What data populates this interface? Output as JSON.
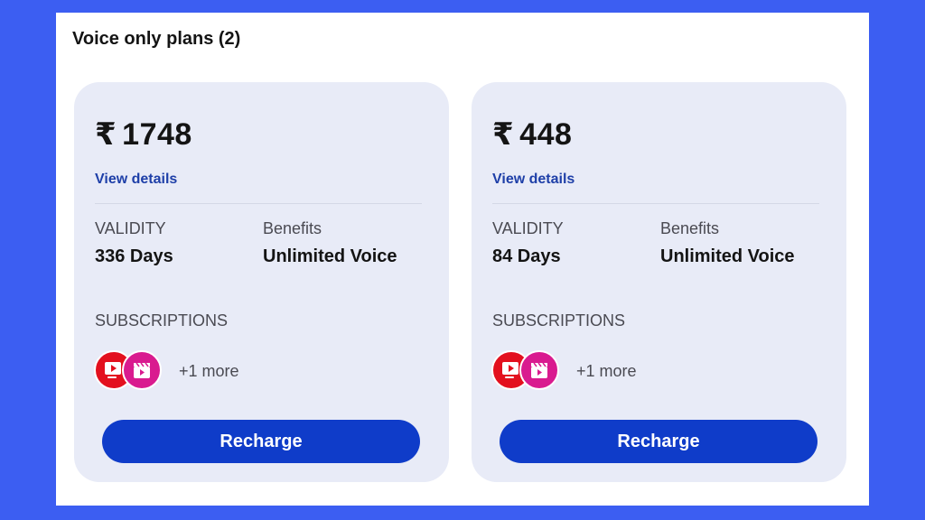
{
  "section": {
    "title": "Voice only plans (2)"
  },
  "labels": {
    "validity": "VALIDITY",
    "benefits": "Benefits",
    "subscriptions": "SUBSCRIPTIONS",
    "view_details": "View details",
    "recharge": "Recharge"
  },
  "plans": [
    {
      "currency": "₹",
      "price": "1748",
      "validity": "336 Days",
      "benefit": "Unlimited Voice",
      "subscription_icons": [
        "tv-play-icon",
        "movie-clapper-icon"
      ],
      "more": "+1 more"
    },
    {
      "currency": "₹",
      "price": "448",
      "validity": "84 Days",
      "benefit": "Unlimited Voice",
      "subscription_icons": [
        "tv-play-icon",
        "movie-clapper-icon"
      ],
      "more": "+1 more"
    }
  ],
  "colors": {
    "background": "#3c5ef2",
    "card": "#e8ebf7",
    "button": "#0f3cc9",
    "link": "#1e3fa8",
    "icon_red": "#e3101e",
    "icon_pink": "#d91b8f"
  }
}
